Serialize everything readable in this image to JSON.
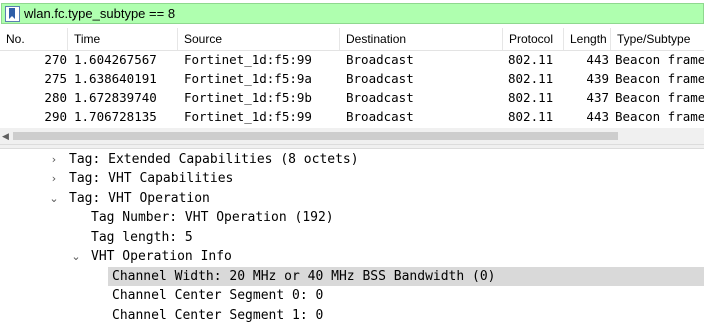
{
  "filter": {
    "text": "wlan.fc.type_subtype == 8"
  },
  "packet_list": {
    "columns": [
      "No.",
      "Time",
      "Source",
      "Destination",
      "Protocol",
      "Length",
      "Type/Subtype"
    ],
    "rows": [
      {
        "no": "270",
        "time": "1.604267567",
        "source": "Fortinet_1d:f5:99",
        "destination": "Broadcast",
        "protocol": "802.11",
        "length": "443",
        "type": "Beacon frame"
      },
      {
        "no": "275",
        "time": "1.638640191",
        "source": "Fortinet_1d:f5:9a",
        "destination": "Broadcast",
        "protocol": "802.11",
        "length": "439",
        "type": "Beacon frame"
      },
      {
        "no": "280",
        "time": "1.672839740",
        "source": "Fortinet_1d:f5:9b",
        "destination": "Broadcast",
        "protocol": "802.11",
        "length": "437",
        "type": "Beacon frame"
      },
      {
        "no": "290",
        "time": "1.706728135",
        "source": "Fortinet_1d:f5:99",
        "destination": "Broadcast",
        "protocol": "802.11",
        "length": "443",
        "type": "Beacon frame"
      }
    ]
  },
  "details": {
    "lines": [
      {
        "text": "Tag: Extended Capabilities (8 octets)",
        "arrow": "collapsed"
      },
      {
        "text": "Tag: VHT Capabilities",
        "arrow": "collapsed"
      },
      {
        "text": "Tag: VHT Operation",
        "arrow": "expanded"
      },
      {
        "text": "Tag Number: VHT Operation (192)",
        "arrow": "none"
      },
      {
        "text": "Tag length: 5",
        "arrow": "none"
      },
      {
        "text": "VHT Operation Info",
        "arrow": "expanded"
      },
      {
        "text": "Channel Width: 20 MHz or 40 MHz BSS Bandwidth (0)",
        "arrow": "none",
        "selected": true
      },
      {
        "text": "Channel Center Segment 0: 0",
        "arrow": "none"
      },
      {
        "text": "Channel Center Segment 1: 0",
        "arrow": "none"
      }
    ]
  },
  "colors": {
    "filter_bg": "#afffaf",
    "selected_bg": "#d9d9d9"
  }
}
